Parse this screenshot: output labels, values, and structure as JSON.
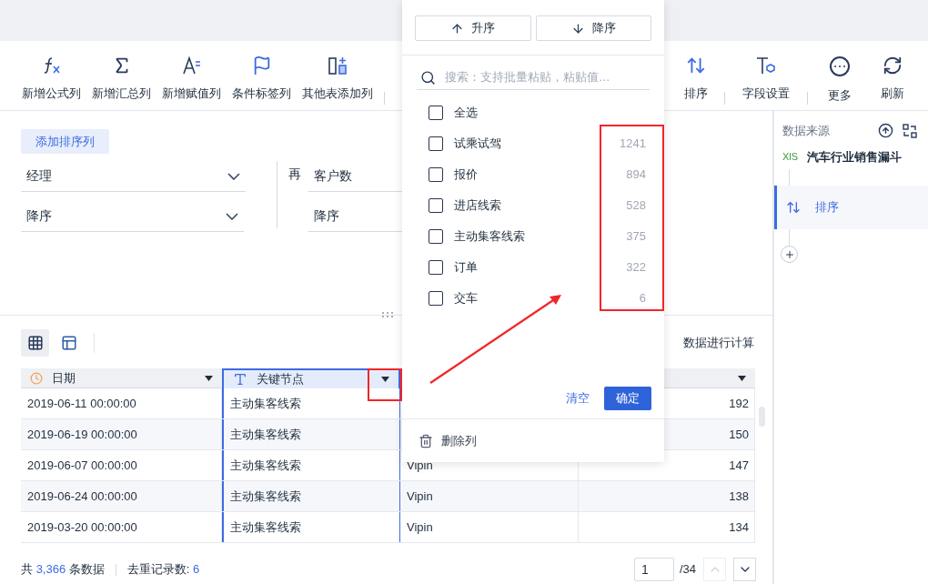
{
  "toolbar": {
    "left": [
      {
        "label": "新增公式列",
        "kind": "formula"
      },
      {
        "label": "新增汇总列",
        "kind": "sum"
      },
      {
        "label": "新增赋值列",
        "kind": "assign"
      },
      {
        "label": "条件标签列",
        "kind": "tag"
      },
      {
        "label": "其他表添加列",
        "kind": "join"
      }
    ],
    "right": [
      {
        "label": "排序",
        "kind": "sort"
      },
      {
        "label": "字段设置",
        "kind": "field"
      },
      {
        "label": "更多",
        "kind": "more"
      },
      {
        "label": "刷新",
        "kind": "refresh"
      }
    ]
  },
  "sort_panel": {
    "add_button": "添加排序列",
    "rules": [
      {
        "field": "经理",
        "order": "降序"
      },
      {
        "prefix": "再",
        "field": "客户数",
        "order": "降序"
      }
    ]
  },
  "table_toolbar": {
    "views": [
      {
        "kind": "grid",
        "selected": true
      },
      {
        "kind": "layout",
        "selected": false
      }
    ],
    "note": "数据进行计算"
  },
  "table": {
    "columns": [
      {
        "name": "日期",
        "kind": "date",
        "selected": false
      },
      {
        "name": "关键节点",
        "kind": "text",
        "selected": true
      },
      {
        "selected": false
      }
    ],
    "rows": [
      {
        "cells": [
          "2019-06-11 00:00:00",
          "主动集客线索",
          null,
          "192"
        ]
      },
      {
        "cells": [
          "2019-06-19 00:00:00",
          "主动集客线索",
          null,
          "150"
        ]
      },
      {
        "cells": [
          "2019-06-07 00:00:00",
          "主动集客线索",
          "Vipin",
          "147"
        ]
      },
      {
        "cells": [
          "2019-06-24 00:00:00",
          "主动集客线索",
          "Vipin",
          "138"
        ]
      },
      {
        "cells": [
          "2019-03-20 00:00:00",
          "主动集客线索",
          "Vipin",
          "134"
        ]
      }
    ]
  },
  "footer": {
    "total_prefix": "共",
    "total": "3,366",
    "total_suffix": "条数据",
    "distinct_label": "去重记录数:",
    "distinct": "6",
    "page": "1",
    "pages": "/34"
  },
  "right_panel": {
    "title": "数据来源",
    "source_type": "XlS",
    "source": "汽车行业销售漏斗",
    "steps": [
      {
        "label": "排序",
        "selected": true
      }
    ]
  },
  "popup": {
    "sort_buttons": [
      {
        "label": "升序",
        "kind": "asc"
      },
      {
        "label": "降序",
        "kind": "desc"
      }
    ],
    "search": {
      "placeholder": "搜索：支持批量粘贴，粘贴值…"
    },
    "options": [
      {
        "label": "全选",
        "checked": false
      },
      {
        "label": "试乘试驾",
        "count": "1241",
        "checked": false
      },
      {
        "label": "报价",
        "count": "894",
        "checked": false
      },
      {
        "label": "进店线索",
        "count": "528",
        "checked": false
      },
      {
        "label": "主动集客线索",
        "count": "375",
        "checked": false
      },
      {
        "label": "订单",
        "count": "322",
        "checked": false
      },
      {
        "label": "交车",
        "count": "6",
        "checked": false
      }
    ],
    "clear": "清空",
    "confirm": "确定",
    "delete": "删除列"
  }
}
